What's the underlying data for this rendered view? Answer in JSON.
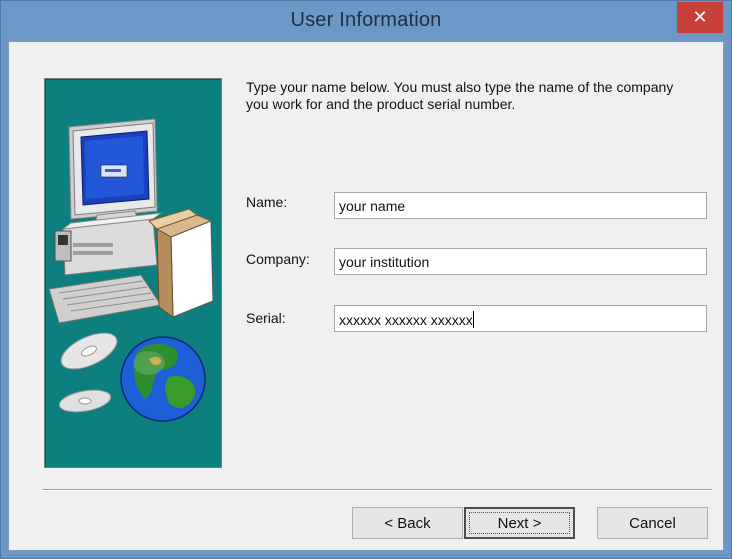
{
  "window": {
    "title": "User Information",
    "close_icon": "close-icon",
    "close_glyph": "✕"
  },
  "instructions": "Type your name below. You must also type the name of the company you work for and the product serial number.",
  "form": {
    "name_label": "Name:",
    "name_value": "your name",
    "company_label": "Company:",
    "company_value": "your institution",
    "serial_label": "Serial:",
    "serial_value": "xxxxxx xxxxxx xxxxxx"
  },
  "buttons": {
    "back": "< Back",
    "next": "Next >",
    "cancel": "Cancel"
  },
  "colors": {
    "title_bar": "#6b98c7",
    "close_button": "#c7403a",
    "art_background": "#0d7f7f"
  }
}
